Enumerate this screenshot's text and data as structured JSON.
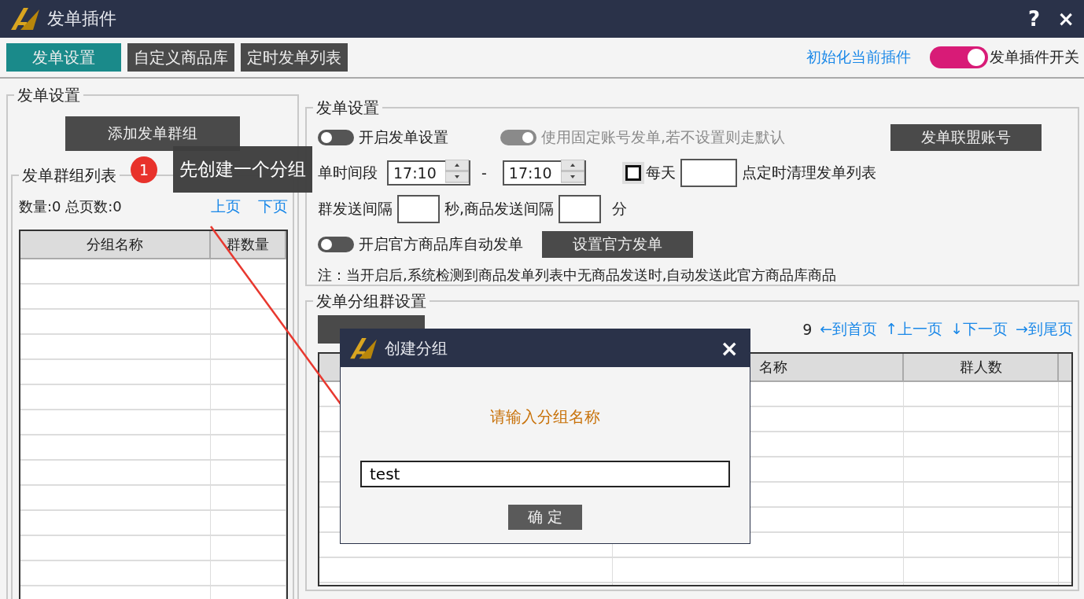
{
  "window": {
    "title": "发单插件",
    "buttons": [
      "?",
      "×"
    ]
  },
  "tabs": [
    {
      "label": "发单设置",
      "selected": true
    },
    {
      "label": "自定义商品库",
      "selected": false
    },
    {
      "label": "定时发单列表",
      "selected": false
    }
  ],
  "header": {
    "link": "初始化当前插件",
    "switch": {
      "label": "发单插件开关",
      "on": true,
      "disabled": false
    }
  },
  "left_panel": {
    "title": "发单设置",
    "add_button": "添加发单群组",
    "group_list": {
      "title": "发单群组列表",
      "stats": "数量:0 总页数:0",
      "links": [
        "上页",
        "下页"
      ],
      "columns": [
        "分组名称",
        "群数量"
      ]
    }
  },
  "send_settings": {
    "title": "发单设置",
    "toggles": [
      {
        "label": "开启发单设置",
        "on": false,
        "disabled": false
      },
      {
        "label": "使用固定账号发单,若不设置则走默认",
        "on": true,
        "disabled": true
      }
    ],
    "account_button": "发单联盟账号",
    "time_row": {
      "label": "单时间段",
      "start": "17:10",
      "separator": "-",
      "end": "17:10",
      "daily": {
        "label": "每天",
        "checked": false
      },
      "suffix": "点定时清理发单列表"
    },
    "interval_row": {
      "label": "群发送间隔",
      "middle": "秒,商品发送间隔",
      "unit": "分"
    },
    "official_toggle": {
      "label": "开启官方商品库自动发单",
      "on": false,
      "disabled": false
    },
    "official_button": "设置官方发单",
    "note": "注：当开启后,系统检测到商品发单列表中无商品发送时,自动发送此官方商品库商品"
  },
  "group_settings": {
    "title": "发单分组群设置",
    "stats": "9",
    "links": [
      "←到首页",
      "↑上一页",
      "↓下一页",
      "→到尾页"
    ],
    "columns": [
      "名称",
      "群人数"
    ]
  },
  "tooltip": {
    "badge": "1",
    "text": "先创建一个分组"
  },
  "dialog": {
    "title": "创建分组",
    "close": "×",
    "prompt": "请输入分组名称",
    "input": {
      "value": "test"
    },
    "button": "确 定"
  }
}
